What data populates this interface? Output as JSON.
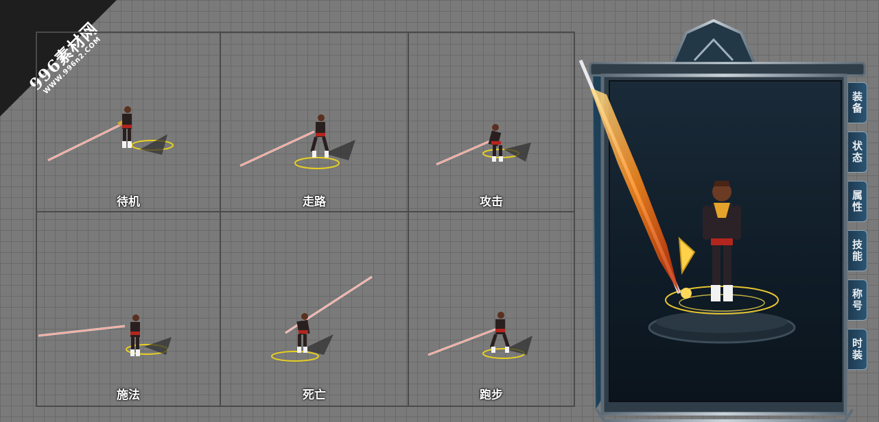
{
  "watermark": {
    "main": "996素材网",
    "sub": "WWW.996n2.COM"
  },
  "animations": [
    {
      "label": "待机"
    },
    {
      "label": "走路"
    },
    {
      "label": "攻击"
    },
    {
      "label": "施法"
    },
    {
      "label": "死亡"
    },
    {
      "label": "跑步"
    }
  ],
  "side_tabs": [
    {
      "label": "装备"
    },
    {
      "label": "状态"
    },
    {
      "label": "属性"
    },
    {
      "label": "技能"
    },
    {
      "label": "称号"
    },
    {
      "label": "时装"
    }
  ],
  "colors": {
    "grid_bg": "#7a7a7a",
    "panel_bg": "#12202c",
    "frame": "#8a97a3",
    "tab_bg": "#24485f",
    "flame": "#ff8a1a"
  }
}
